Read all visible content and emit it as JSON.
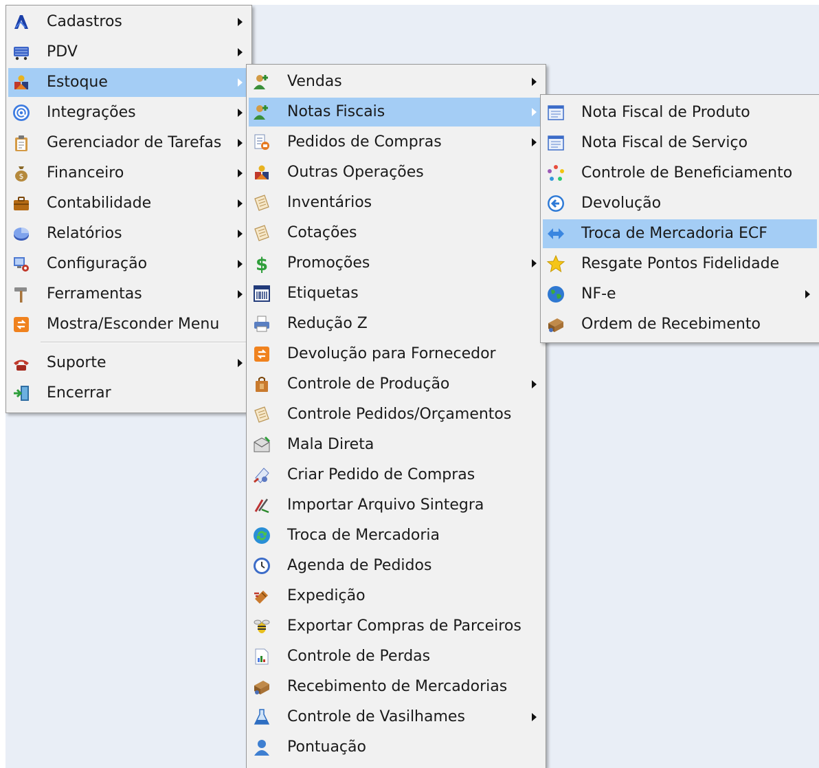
{
  "main_menu": {
    "items": [
      {
        "label": "Cadastros",
        "icon": "cadastros-icon",
        "submenu": true
      },
      {
        "label": "PDV",
        "icon": "pdv-cart-icon",
        "submenu": true
      },
      {
        "label": "Estoque",
        "icon": "estoque-icon",
        "submenu": true,
        "highlighted": true
      },
      {
        "label": "Integrações",
        "icon": "at-sign-icon",
        "submenu": true
      },
      {
        "label": "Gerenciador de Tarefas",
        "icon": "clipboard-icon",
        "submenu": true
      },
      {
        "label": "Financeiro",
        "icon": "money-bag-icon",
        "submenu": true
      },
      {
        "label": "Contabilidade",
        "icon": "briefcase-icon",
        "submenu": true
      },
      {
        "label": "Relatórios",
        "icon": "pie-chart-icon",
        "submenu": true
      },
      {
        "label": "Configuração",
        "icon": "settings-computer-icon",
        "submenu": true
      },
      {
        "label": "Ferramentas",
        "icon": "hammer-icon",
        "submenu": true
      },
      {
        "label": "Mostra/Esconder Menu",
        "icon": "toggle-menu-icon",
        "submenu": false
      },
      {
        "label": "Suporte",
        "icon": "telephone-icon",
        "submenu": true
      },
      {
        "label": "Encerrar",
        "icon": "exit-door-icon",
        "submenu": false
      }
    ]
  },
  "estoque_menu": {
    "items": [
      {
        "label": "Vendas",
        "icon": "users-icon",
        "submenu": true
      },
      {
        "label": "Notas Fiscais",
        "icon": "users-icon",
        "submenu": true,
        "highlighted": true
      },
      {
        "label": "Pedidos de Compras",
        "icon": "purchase-order-icon",
        "submenu": true
      },
      {
        "label": "Outras Operações",
        "icon": "estoque-icon",
        "submenu": false
      },
      {
        "label": "Inventários",
        "icon": "notepad-icon",
        "submenu": false
      },
      {
        "label": "Cotações",
        "icon": "notepad-icon",
        "submenu": false
      },
      {
        "label": "Promoções",
        "icon": "dollar-icon",
        "submenu": true
      },
      {
        "label": "Etiquetas",
        "icon": "barcode-icon",
        "submenu": false
      },
      {
        "label": "Redução Z",
        "icon": "printer-icon",
        "submenu": false
      },
      {
        "label": "Devolução para Fornecedor",
        "icon": "toggle-menu-icon",
        "submenu": false
      },
      {
        "label": "Controle de Produção",
        "icon": "bag-icon",
        "submenu": true
      },
      {
        "label": "Controle Pedidos/Orçamentos",
        "icon": "notepad-icon",
        "submenu": false
      },
      {
        "label": "Mala Direta",
        "icon": "mail-icon",
        "submenu": false
      },
      {
        "label": "Criar Pedido de Compras",
        "icon": "create-order-icon",
        "submenu": false
      },
      {
        "label": "Importar Arquivo Sintegra",
        "icon": "import-icon",
        "submenu": false
      },
      {
        "label": "Troca de Mercadoria",
        "icon": "refresh-icon",
        "submenu": false
      },
      {
        "label": "Agenda de Pedidos",
        "icon": "clock-icon",
        "submenu": false
      },
      {
        "label": "Expedição",
        "icon": "shipping-icon",
        "submenu": false
      },
      {
        "label": "Exportar Compras de Parceiros",
        "icon": "bee-icon",
        "submenu": false
      },
      {
        "label": "Controle de Perdas",
        "icon": "report-icon",
        "submenu": false
      },
      {
        "label": "Recebimento de Mercadorias",
        "icon": "boxes-icon",
        "submenu": false
      },
      {
        "label": "Controle de Vasilhames",
        "icon": "flask-icon",
        "submenu": true
      },
      {
        "label": "Pontuação",
        "icon": "user-icon",
        "submenu": false
      }
    ]
  },
  "notas_menu": {
    "items": [
      {
        "label": "Nota Fiscal de Produto",
        "icon": "form-icon",
        "submenu": false
      },
      {
        "label": "Nota Fiscal de Serviço",
        "icon": "form-icon",
        "submenu": false
      },
      {
        "label": "Controle de Beneficiamento",
        "icon": "cycle-icon",
        "submenu": false
      },
      {
        "label": "Devolução",
        "icon": "back-arrow-icon",
        "submenu": false
      },
      {
        "label": "Troca de Mercadoria ECF",
        "icon": "exchange-arrows-icon",
        "submenu": false,
        "highlighted": true
      },
      {
        "label": "Resgate Pontos Fidelidade",
        "icon": "star-icon",
        "submenu": false
      },
      {
        "label": "NF-e",
        "icon": "globe-icon",
        "submenu": true
      },
      {
        "label": "Ordem de Recebimento",
        "icon": "boxes-icon",
        "submenu": false
      }
    ]
  },
  "colors": {
    "menu_bg": "#f1f1f1",
    "highlight": "#a4cdf5",
    "desktop_bg": "#e9eef6"
  }
}
